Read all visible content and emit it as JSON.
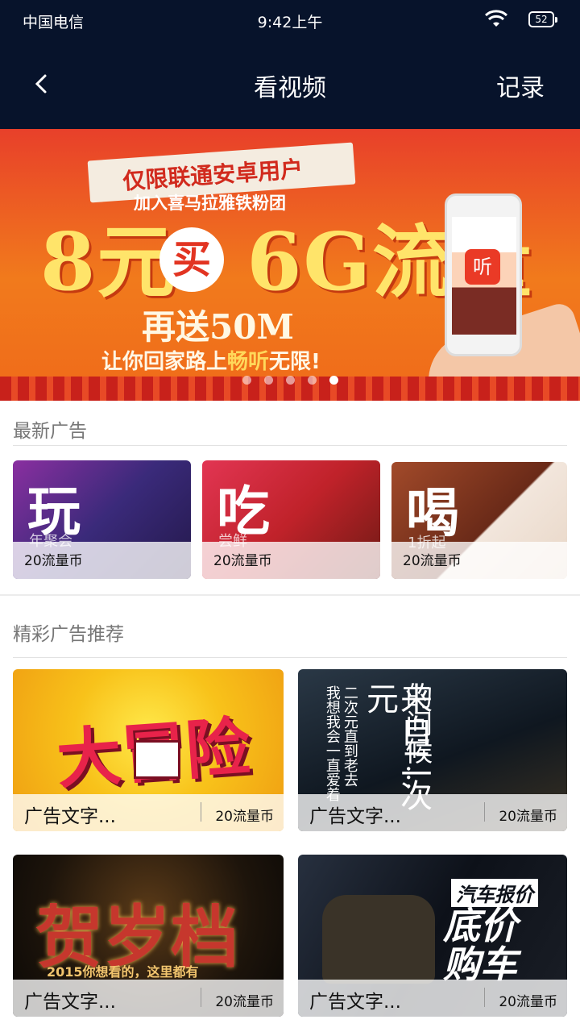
{
  "status": {
    "carrier": "中国电信",
    "time": "9:42上午",
    "battery": "52"
  },
  "nav": {
    "title": "看视频",
    "record": "记录"
  },
  "banner": {
    "ribbon": "仅限联通安卓用户",
    "sub": "加入喜马拉雅铁粉团",
    "big_left": "8元",
    "buy": "买",
    "big_right": "6G流量",
    "gift": "再送50M",
    "slogan_a": "让你回家路上",
    "slogan_b": "畅听",
    "slogan_c": "无限!",
    "phone_icon": "听",
    "active_dot": 4
  },
  "latest": {
    "heading": "最新广告",
    "cards": [
      {
        "char": "玩",
        "tag": "年聚会",
        "coin": "20流量币"
      },
      {
        "char": "吃",
        "tag": "尝鲜",
        "coin": "20流量币"
      },
      {
        "char": "喝",
        "tag": "1折起",
        "coin": "20流量币"
      }
    ]
  },
  "featured": {
    "heading": "精彩广告推荐",
    "items": [
      {
        "title": "广告文字...",
        "coin": "20流量币",
        "art": "大冒险"
      },
      {
        "title": "广告文字...",
        "coin": "20流量币",
        "art_a": "来自二次元",
        "art_b": "的问候...",
        "art_c": "二次元直到老去",
        "art_d": "我想我会一直爱着"
      },
      {
        "title": "广告文字...",
        "coin": "20流量币",
        "art": "贺岁档",
        "art_sub": "2015你想看的，这里都有"
      },
      {
        "title": "广告文字...",
        "coin": "20流量币",
        "art_a": "汽车报价",
        "art_b": "底价",
        "art_c": "购车"
      }
    ]
  },
  "colors": {
    "header": "#07132b",
    "accent": "#e23422"
  }
}
